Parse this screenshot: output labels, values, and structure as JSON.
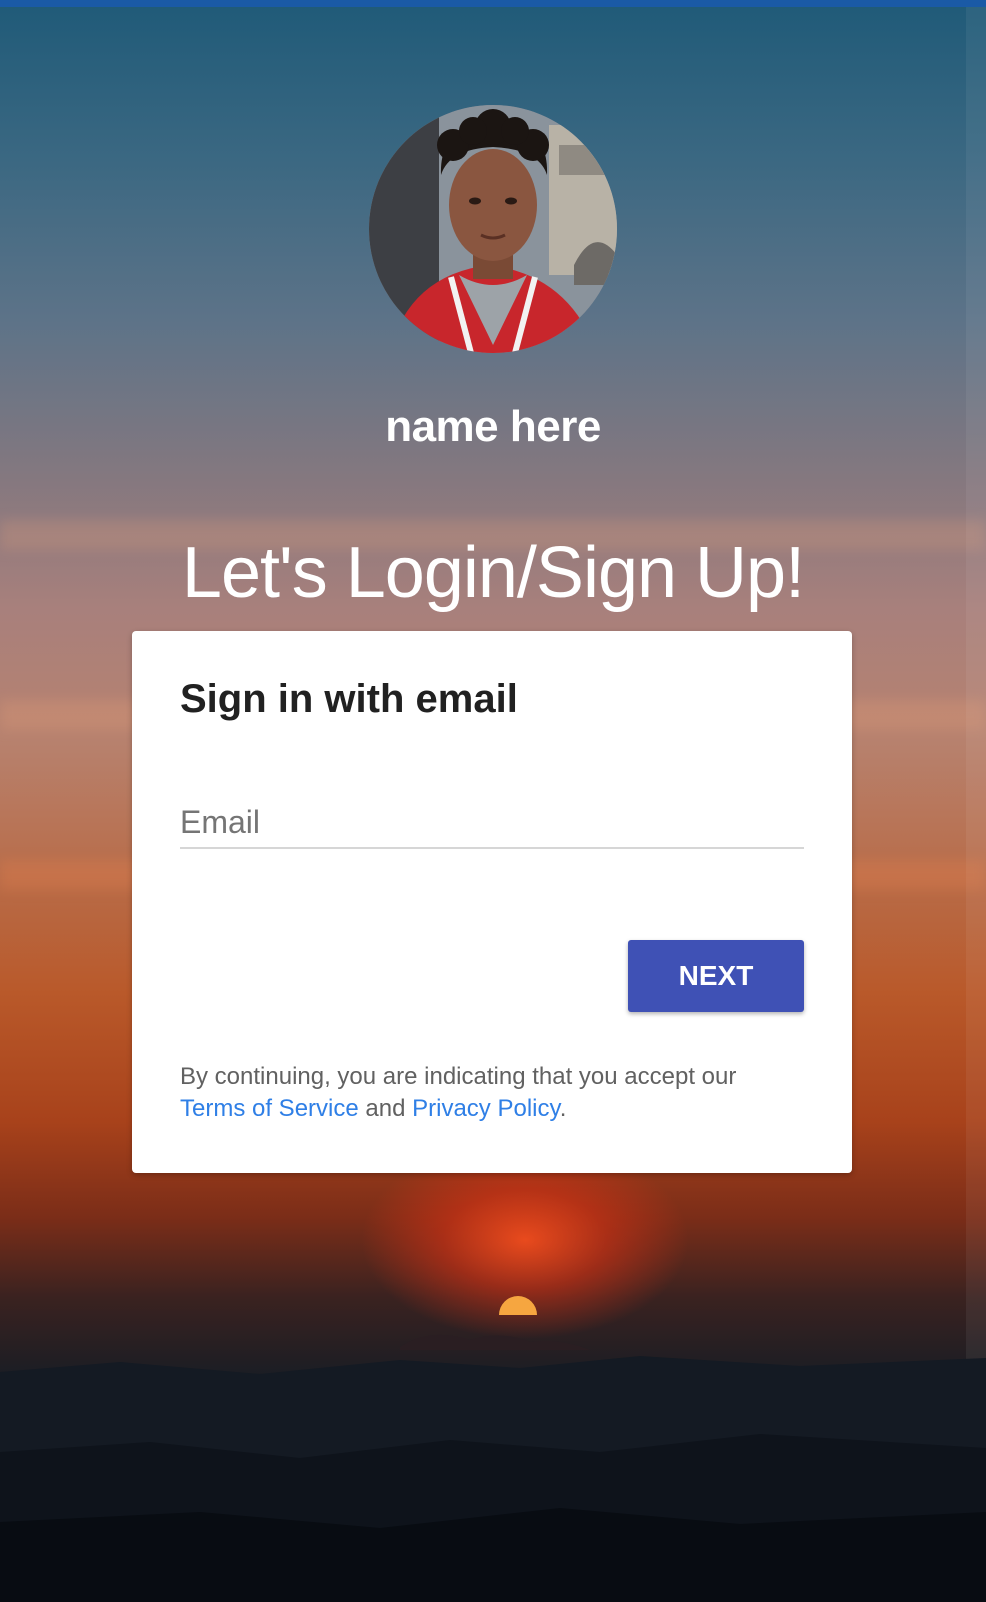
{
  "profile": {
    "name": "name here",
    "avatar_icon": "person-photo"
  },
  "headline": "Let's Login/Sign Up!",
  "signin_card": {
    "title": "Sign in with email",
    "email_placeholder": "Email",
    "email_value": "",
    "next_label": "NEXT",
    "terms_prefix": "By continuing, you are indicating that you accept our",
    "terms_link": "Terms of Service",
    "terms_and": "and",
    "privacy_link": "Privacy Policy",
    "terms_suffix": "."
  },
  "colors": {
    "accent": "#3f51b5",
    "link": "#2f7fe6",
    "top_bar": "#1a5aa6"
  }
}
